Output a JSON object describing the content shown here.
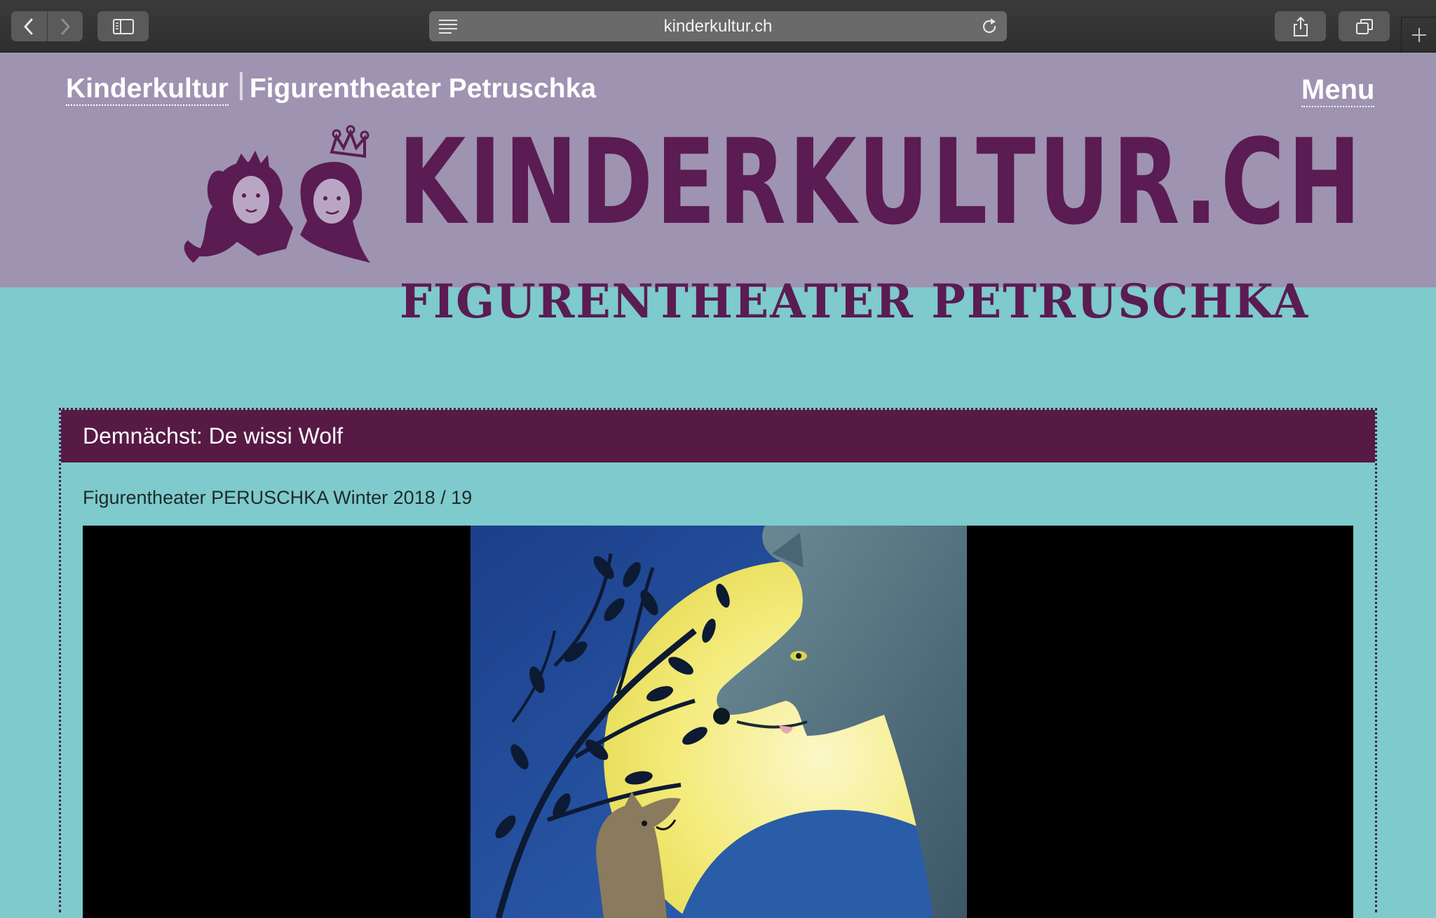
{
  "browser": {
    "url": "kinderkultur.ch",
    "icons": {
      "back": "chevron-left-icon",
      "forward": "chevron-right-icon",
      "sidebar": "sidebar-icon",
      "reader": "reader-icon",
      "reload": "reload-icon",
      "share": "share-icon",
      "tabs": "tabs-icon",
      "new_tab": "plus-icon"
    }
  },
  "site": {
    "nav": {
      "home_link": "Kinderkultur",
      "subtitle": "Figurentheater Petruschka",
      "menu": "Menu"
    },
    "logo": {
      "main_text": "KINDERKULTUR.CH",
      "sub_text": "FIGURENTHEATER PETRUSCHKA"
    },
    "colors": {
      "header_bg": "#9e93b1",
      "page_bg": "#7ecacc",
      "brand": "#5a1c52",
      "card_title_bg": "#561a45"
    }
  },
  "content": {
    "card_title": "Demnächst: De wissi Wolf",
    "lead": "Figurentheater PERUSCHKA Winter 2018 / 19"
  }
}
